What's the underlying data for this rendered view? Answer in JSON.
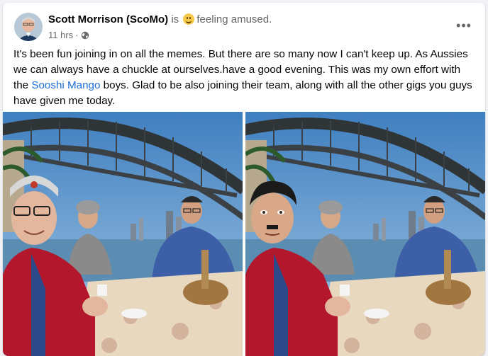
{
  "post": {
    "author": "Scott Morrison (ScoMo)",
    "is_text": "is",
    "feeling_text": "feeling amused.",
    "feeling_icon": "smiley-emoji-icon",
    "timestamp": "11 hrs",
    "separator": "·",
    "audience_icon": "globe-icon",
    "more_icon": "more-options-icon",
    "more_label": "•••",
    "body_part1": "It's been fun joining in on all the memes. But there are so many now I can't keep up. As Aussies we can always have a chuckle at ourselves.have a good evening. This was my own effort with the ",
    "body_link": "Sooshi Mango",
    "body_part2": " boys. Glad to be also joining their team, along with all the other gigs you guys have given me today."
  },
  "photos": [
    {
      "name": "meme-photo-original"
    },
    {
      "name": "meme-photo-edited"
    }
  ],
  "colors": {
    "link": "#216fdb",
    "secondary_text": "#65676b",
    "emoji": "#f7c948"
  }
}
